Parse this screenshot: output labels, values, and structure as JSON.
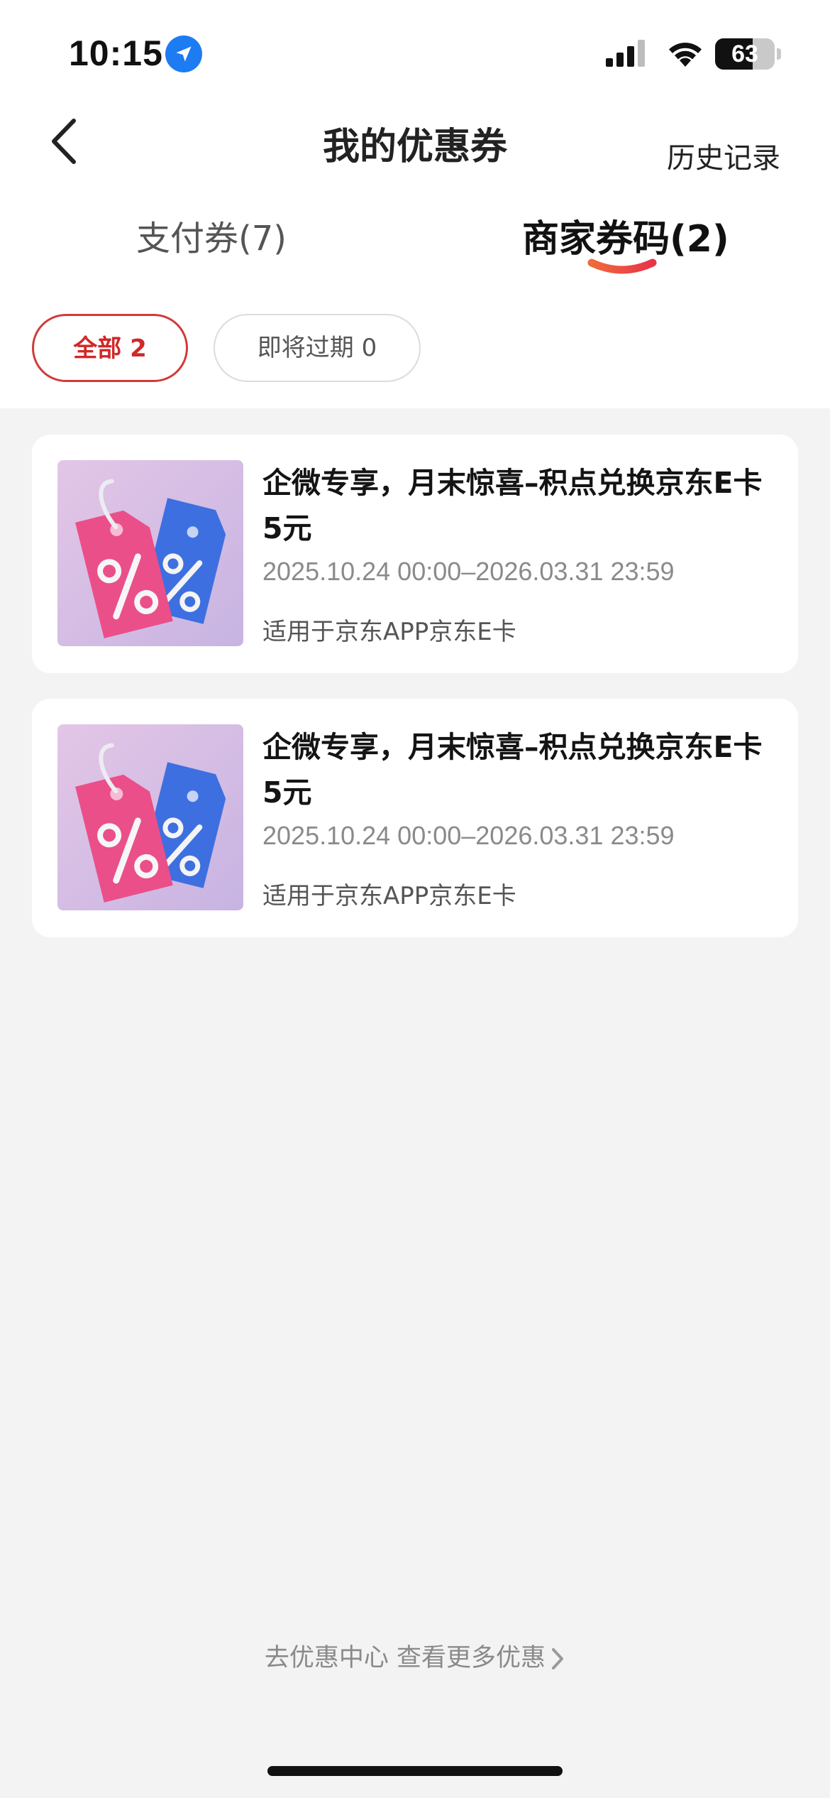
{
  "status_bar": {
    "time": "10:15",
    "battery": "63",
    "battery_level": 0.63,
    "icons": [
      "location-arrow-icon",
      "signal-icon",
      "wifi-icon",
      "battery-icon"
    ]
  },
  "nav": {
    "title": "我的优惠券",
    "history": "历史记录",
    "back_icon": "chevron-left-icon"
  },
  "tabs": [
    {
      "label": "支付券(7)",
      "active": false
    },
    {
      "label": "商家券码(2)",
      "active": true
    }
  ],
  "filters": [
    {
      "label": "全部 2",
      "active": true
    },
    {
      "label": "即将过期 0",
      "active": false
    }
  ],
  "coupons": [
    {
      "title": "企微专享，月末惊喜–积点兑换京东E卡5元",
      "date": "2025.10.24 00:00–2026.03.31 23:59",
      "scope": "适用于京东APP京东E卡",
      "image": "discount-tag-icon"
    },
    {
      "title": "企微专享，月末惊喜–积点兑换京东E卡5元",
      "date": "2025.10.24 00:00–2026.03.31 23:59",
      "scope": "适用于京东APP京东E卡",
      "image": "discount-tag-icon"
    }
  ],
  "footer": {
    "link": "去优惠中心 查看更多优惠"
  },
  "colors": {
    "accent": "#d12828",
    "tab_underline": "#f0553c",
    "background": "#f3f3f3"
  }
}
